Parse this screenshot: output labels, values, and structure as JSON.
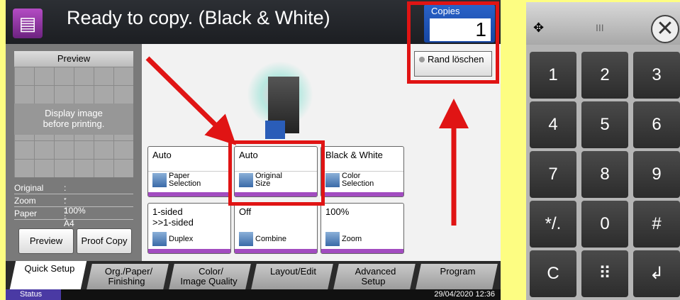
{
  "header": {
    "title": "Ready to copy. (Black & White)"
  },
  "copies": {
    "label": "Copies",
    "value": "1"
  },
  "rand_button": {
    "label": "Rand löschen"
  },
  "preview": {
    "header": "Preview",
    "message_line1": "Display image",
    "message_line2": "before printing.",
    "info": [
      {
        "label": "Original",
        "value": ": ---"
      },
      {
        "label": "Zoom",
        "value": ": 100%"
      },
      {
        "label": "Paper",
        "value": ": A4"
      }
    ],
    "preview_btn": "Preview",
    "proof_btn": "Proof Copy"
  },
  "functions": [
    {
      "value": "Auto",
      "label1": "Paper",
      "label2": "Selection"
    },
    {
      "value": "Auto",
      "label1": "Original",
      "label2": "Size"
    },
    {
      "value": "Black & White",
      "label1": "Color",
      "label2": "Selection"
    },
    {
      "value": "1-sided\n>>1-sided",
      "label1": "Duplex",
      "label2": ""
    },
    {
      "value": "Off",
      "label1": "Combine",
      "label2": ""
    },
    {
      "value": "100%",
      "label1": "Zoom",
      "label2": ""
    }
  ],
  "tabs": [
    {
      "line1": "Quick Setup",
      "line2": ""
    },
    {
      "line1": "Org./Paper/",
      "line2": "Finishing"
    },
    {
      "line1": "Color/",
      "line2": "Image Quality"
    },
    {
      "line1": "Layout/Edit",
      "line2": ""
    },
    {
      "line1": "Advanced",
      "line2": "Setup"
    },
    {
      "line1": "Program",
      "line2": ""
    }
  ],
  "status": {
    "label": "Status",
    "datetime": "29/04/2020  12:36"
  },
  "keypad": {
    "keys": [
      "1",
      "2",
      "3",
      "4",
      "5",
      "6",
      "7",
      "8",
      "9",
      "*/.",
      "0",
      "#",
      "C",
      "⠿",
      "↲"
    ],
    "drag_glyph": "III"
  },
  "colors": {
    "highlight": "#e01414",
    "accent": "#a24cc0",
    "copies_blue": "#1e56b8"
  },
  "icons": [
    "document-icon",
    "copier-icon",
    "close-icon",
    "move-icon",
    "arrow-icon"
  ]
}
